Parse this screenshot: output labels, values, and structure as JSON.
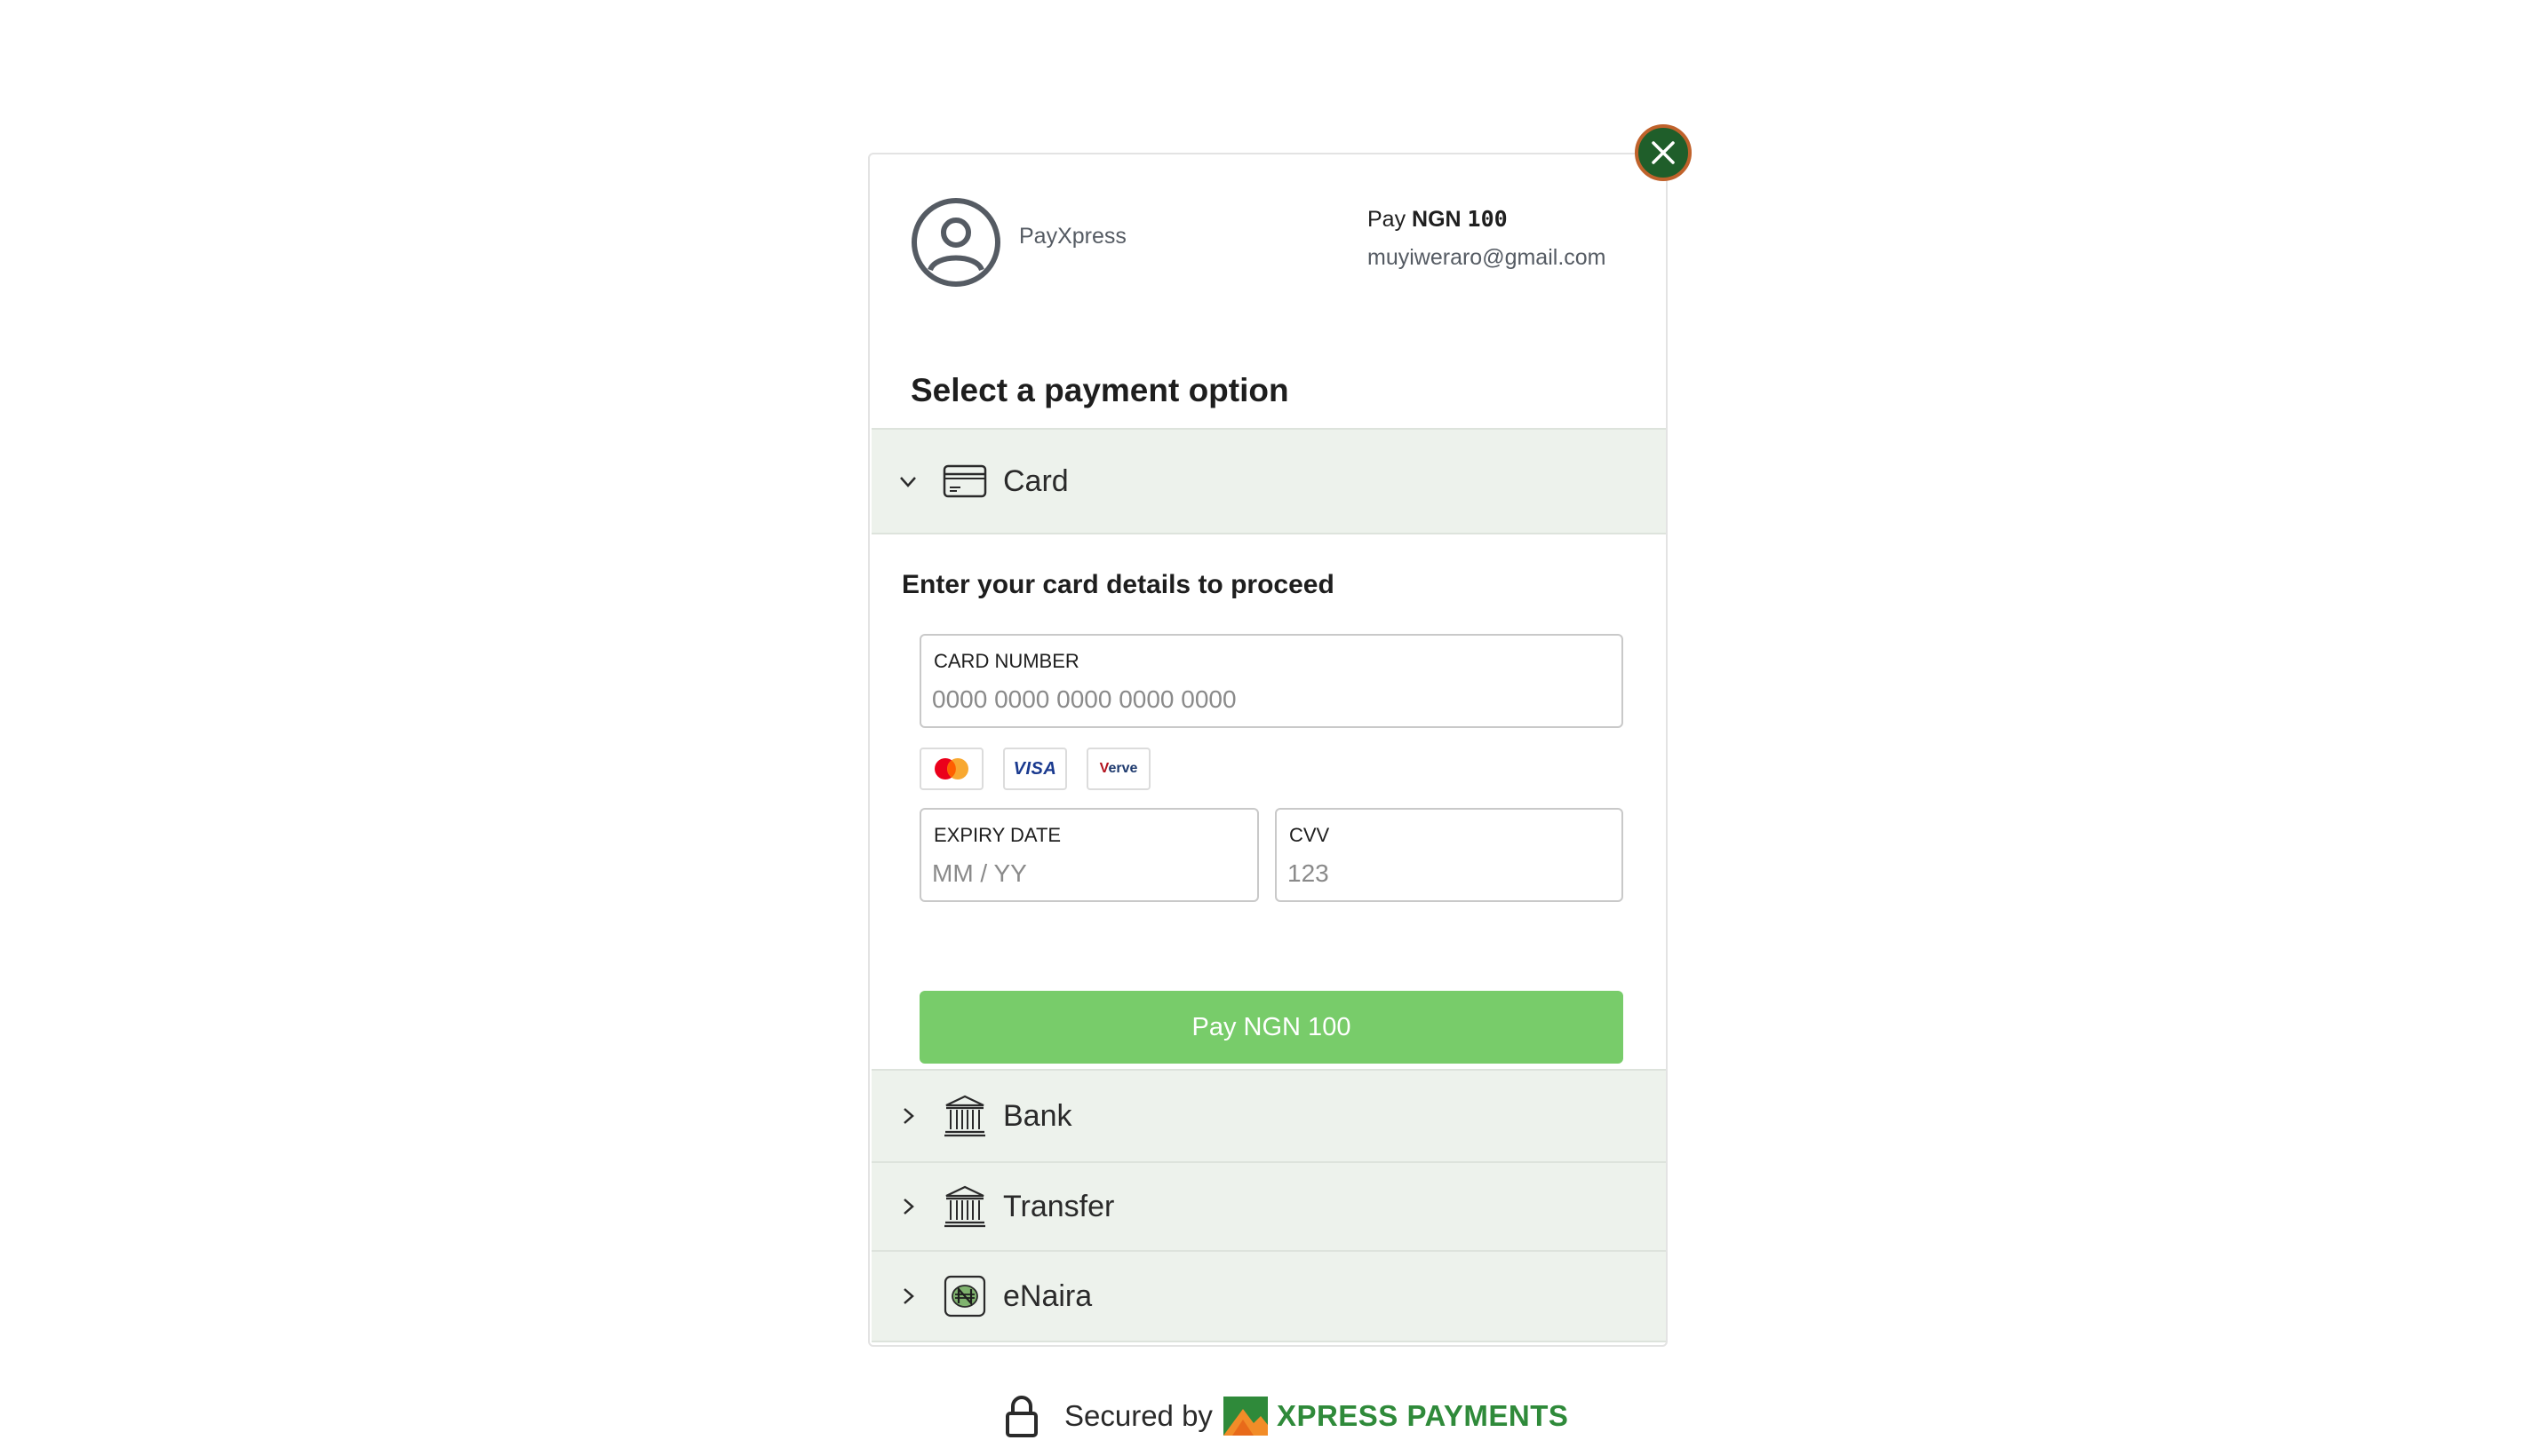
{
  "header": {
    "merchant_name": "PayXpress",
    "pay_prefix": "Pay ",
    "currency": "NGN ",
    "amount": "100",
    "email": "muyiweraro@gmail.com"
  },
  "section_title": "Select a payment option",
  "options": {
    "card": {
      "label": "Card",
      "icon": "card-icon",
      "expanded": true
    },
    "bank": {
      "label": "Bank",
      "icon": "bank-icon"
    },
    "transfer": {
      "label": "Transfer",
      "icon": "bank-icon"
    },
    "enaira": {
      "label": "eNaira",
      "icon": "enaira-icon"
    }
  },
  "card_form": {
    "title": "Enter your card details to proceed",
    "card_number_label": "CARD NUMBER",
    "card_number_placeholder": "0000 0000 0000 0000 0000",
    "expiry_label": "EXPIRY DATE",
    "expiry_placeholder": "MM / YY",
    "cvv_label": "CVV",
    "cvv_placeholder": "123",
    "brands": {
      "visa": "VISA",
      "verve_v": "V",
      "verve_rest": "erve"
    },
    "pay_button": "Pay NGN 100"
  },
  "footer": {
    "secured_by": "Secured by",
    "brand": "XPRESS PAYMENTS"
  },
  "colors": {
    "close_button": "#1f5e2a",
    "close_ring": "#c0622b",
    "accordion_bg": "#edf2ec",
    "pay_button": "#78cc6a",
    "brand_green": "#2f8a3a"
  }
}
